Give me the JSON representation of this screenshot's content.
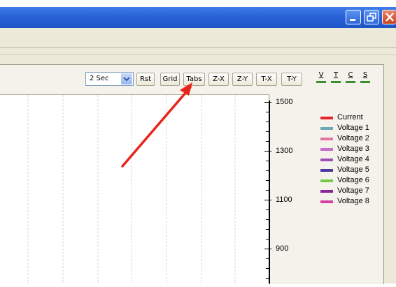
{
  "window": {
    "title_buttons": [
      "minimize",
      "maximize",
      "close"
    ]
  },
  "toolbar": {
    "interval": {
      "selected": "2 Sec"
    },
    "buttons": [
      "Rst",
      "Grid",
      "Tabs",
      "Z-X",
      "Z-Y",
      "T-X",
      "T-Y"
    ],
    "channel_buttons": [
      "V",
      "T",
      "C",
      "S"
    ]
  },
  "chart": {
    "y_ticks": [
      "1500",
      "1300",
      "1100",
      "900"
    ],
    "legend": [
      {
        "label": "Current",
        "color": "#e8262a"
      },
      {
        "label": "Voltage 1",
        "color": "#6fa9b3"
      },
      {
        "label": "Voltage 2",
        "color": "#e275a6"
      },
      {
        "label": "Voltage 3",
        "color": "#c770c9"
      },
      {
        "label": "Voltage 4",
        "color": "#9b50b4"
      },
      {
        "label": "Voltage 5",
        "color": "#4a39a0"
      },
      {
        "label": "Voltage 6",
        "color": "#74c947"
      },
      {
        "label": "Voltage 7",
        "color": "#8a2795"
      },
      {
        "label": "Voltage 8",
        "color": "#d83fa4"
      }
    ]
  },
  "annotation": {
    "arrow_color": "#e8241c",
    "points_to": "Tabs"
  }
}
